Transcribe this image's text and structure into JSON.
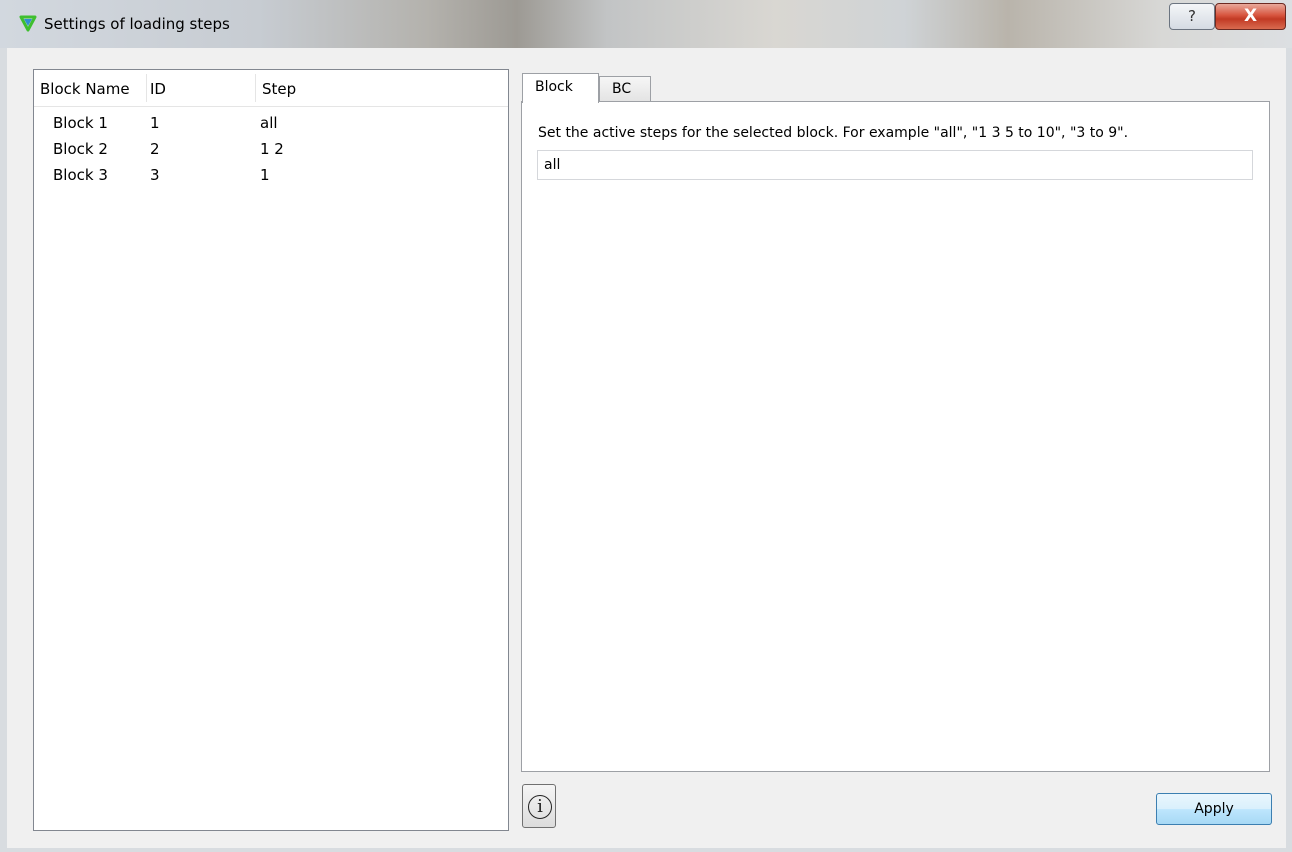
{
  "window": {
    "title": "Settings of loading steps",
    "help_label": "?",
    "close_label": "X"
  },
  "tree": {
    "columns": [
      "Block Name",
      "ID",
      "Step"
    ],
    "rows": [
      {
        "name": "Block 1",
        "id": "1",
        "step": "all"
      },
      {
        "name": "Block 2",
        "id": "2",
        "step": "1 2"
      },
      {
        "name": "Block 3",
        "id": "3",
        "step": "1"
      }
    ]
  },
  "tabs": [
    {
      "label": "Block",
      "active": true
    },
    {
      "label": "BC",
      "active": false
    }
  ],
  "block_tab": {
    "hint": "Set the active steps for the selected block. For example \"all\", \"1 3 5 to 10\", \"3 to 9\".",
    "steps_value": "all"
  },
  "buttons": {
    "info_label": "i",
    "apply_label": "Apply"
  },
  "colors": {
    "close_red": "#c23a24",
    "apply_blue": "#3c7fb1",
    "icon_green": "#3fbf2f",
    "icon_blue": "#2f8fd0"
  }
}
